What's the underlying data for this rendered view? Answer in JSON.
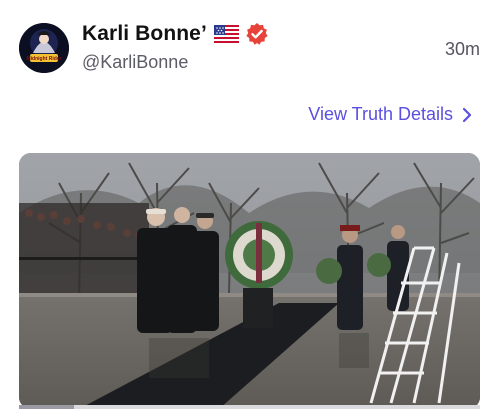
{
  "post": {
    "author": {
      "display_name": "Karli Bonne’",
      "handle": "@KarliBonne",
      "avatar_text": "Midnight Rider",
      "flag_icon": "us-flag-icon",
      "verified_icon": "verified-badge-icon",
      "verified_color": "#e8433b"
    },
    "timestamp": "30m",
    "details_link": {
      "label": "View Truth Details",
      "icon": "chevron-right-icon",
      "color": "#5b4fe0"
    },
    "media": {
      "type": "image",
      "progress": 0.12
    }
  }
}
